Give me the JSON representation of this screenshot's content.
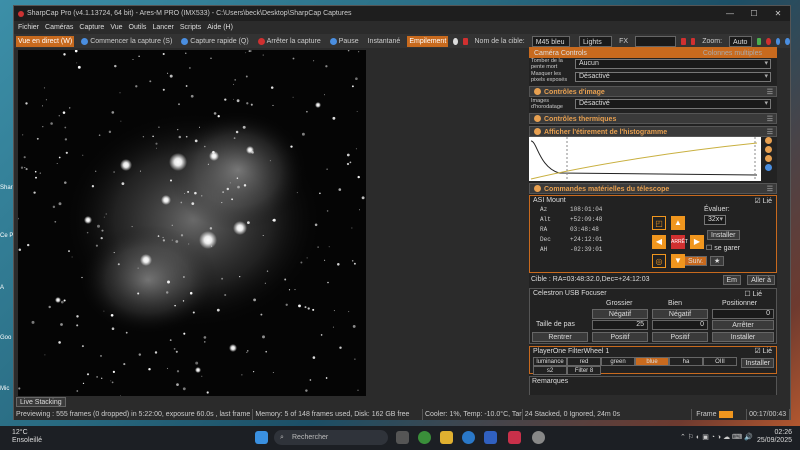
{
  "window": {
    "title": "SharpCap Pro (v4.1.13724, 64 bit) - Ares-M PRO (IMX533) - C:\\Users\\beck\\Desktop\\SharpCap Captures",
    "minimize": "—",
    "maximize": "☐",
    "close": "✕"
  },
  "menu": [
    "Fichier",
    "Caméras",
    "Capture",
    "Vue",
    "Outils",
    "Lancer",
    "Scripts",
    "Aide (H)"
  ],
  "toolbar": {
    "live": "Vue en direct (W)",
    "start": "Commencer la capture (S)",
    "quick": "Capture rapide (Q)",
    "stop": "Arrêter la capture",
    "pause": "Pause",
    "snapshot": "Instantané",
    "stack": "Empilement",
    "target_label": "Nom de la cible:",
    "target_value": "M45 bleu",
    "frame_type": "Lights",
    "fx": "FX",
    "zoom_label": "Zoom:",
    "zoom_value": "Auto"
  },
  "live_stacking": "Live Stacking",
  "status": {
    "preview": "Previewing : 555 frames (0 dropped) in 5:22:00, exposure 60.0s , last frame 60.0s",
    "memory": "Memory: 5 of 148 frames used, Disk: 162 GB free",
    "cooler": "Cooler: 1%, Temp: -10.0°C, Target: -10.0°C",
    "stacked": "24 Stacked, 0 Ignored, 24m 0s",
    "frame": "Frame",
    "time": "00:17/00:43"
  },
  "panel": {
    "camera_controls": "Caméra Controls",
    "multiple_cols": "Colonnes multiples",
    "cut_dark_label": "Tomber de la pente mort",
    "cut_dark_value": "Aucun",
    "mask_hot_label": "Masquer les pixels exposés",
    "mask_hot_value": "Désactivé",
    "image_controls": "Contrôles d'image",
    "timestamp_label": "Images d'horodatage",
    "timestamp_value": "Désactivé",
    "thermal_controls": "Contrôles thermiques",
    "histogram": "Afficher l'étirement de l'histogramme",
    "hardware": "Commandes matérielles du télescope",
    "mount_name": "ASI Mount",
    "linked": "Lié",
    "slew_label": "Évaluer:",
    "slew_value": "32x",
    "az_l": "Az",
    "az_v": "108:01:04",
    "alt_l": "Alt",
    "alt_v": "+52:09:48",
    "ra_l": "RA",
    "ra_v": "03:48:48",
    "dec_l": "Dec",
    "dec_v": "+24:12:01",
    "ah_l": "AH",
    "ah_v": "-02:39:01",
    "install": "Installer",
    "park": "se garer",
    "stop": "ARRÊT",
    "follow": "Suiv.",
    "target": "Cible : RA=03:48:32.0,Dec=+24:12:03",
    "goto": "Aller à",
    "emp": "Em",
    "focuser": "Celestron USB Focuser",
    "coarse": "Grossier",
    "fine": "Bien",
    "position": "Positionner",
    "neg": "Négatif",
    "neg2": "Négatif",
    "pos_val": "0",
    "step_label": "Taille de pas",
    "step_coarse": "25",
    "step_fine": "0",
    "stop_btn": "Arrêter",
    "retract": "Rentrer",
    "pos1": "Positif",
    "pos2": "Positif",
    "install2": "Installer",
    "filterwheel": "PlayerOne FilterWheel 1",
    "filters": [
      "luminance",
      "red",
      "green",
      "blue",
      "ha",
      "OIII",
      "s2",
      "Filter 8"
    ],
    "install3": "Installer",
    "remarks": "Remarques"
  },
  "taskbar": {
    "temp": "12°C",
    "weather": "Ensoleillé",
    "search": "Rechercher",
    "time": "02:26",
    "date": "25/09/2025"
  },
  "desktop_icons": [
    "Sharp",
    "Ce P",
    "A",
    "Goo",
    "Mic"
  ]
}
